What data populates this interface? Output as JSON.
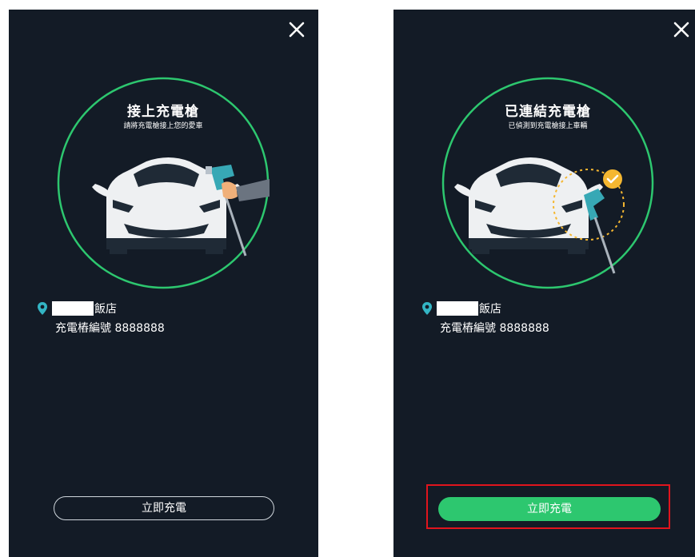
{
  "colors": {
    "background": "#131b26",
    "accent_green": "#2dc76f",
    "circle_stroke": "#2dc76f",
    "pin": "#33b5c4",
    "check_badge": "#f5b731",
    "highlight": "#e0141d"
  },
  "screens": [
    {
      "title": "接上充電槍",
      "subtitle": "請將充電槍接上您的愛車",
      "location_suffix": "飯店",
      "station_id": "充電樁編號 8888888",
      "button_label": "立即充電",
      "button_style": "outline",
      "close_icon": "close-icon"
    },
    {
      "title": "已連結充電槍",
      "subtitle": "已偵測到充電槍接上車輛",
      "location_suffix": "飯店",
      "station_id": "充電樁編號 8888888",
      "button_label": "立即充電",
      "button_style": "filled",
      "close_icon": "close-icon",
      "connected_icon": "check-circle-icon"
    }
  ]
}
